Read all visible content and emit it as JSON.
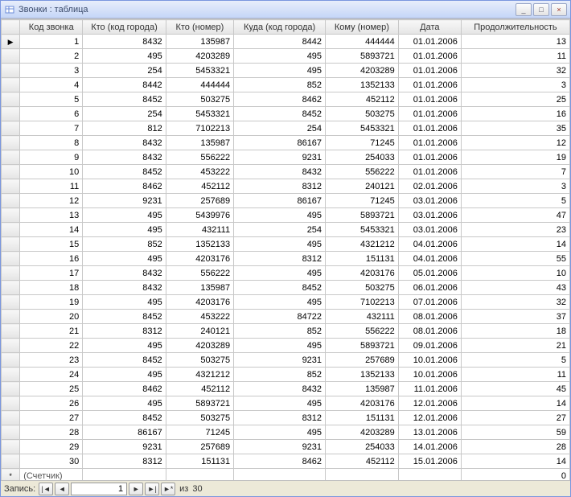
{
  "window": {
    "title": "Звонки : таблица",
    "minimize": "_",
    "maximize": "□",
    "close": "×"
  },
  "columns": [
    "Код звонка",
    "Кто (код города)",
    "Кто (номер)",
    "Куда (код города)",
    "Кому (номер)",
    "Дата",
    "Продолжительность"
  ],
  "rows": [
    {
      "marker": "▶",
      "c": [
        "1",
        "8432",
        "135987",
        "8442",
        "444444",
        "01.01.2006",
        "13"
      ]
    },
    {
      "marker": "",
      "c": [
        "2",
        "495",
        "4203289",
        "495",
        "5893721",
        "01.01.2006",
        "11"
      ]
    },
    {
      "marker": "",
      "c": [
        "3",
        "254",
        "5453321",
        "495",
        "4203289",
        "01.01.2006",
        "32"
      ]
    },
    {
      "marker": "",
      "c": [
        "4",
        "8442",
        "444444",
        "852",
        "1352133",
        "01.01.2006",
        "3"
      ]
    },
    {
      "marker": "",
      "c": [
        "5",
        "8452",
        "503275",
        "8462",
        "452112",
        "01.01.2006",
        "25"
      ]
    },
    {
      "marker": "",
      "c": [
        "6",
        "254",
        "5453321",
        "8452",
        "503275",
        "01.01.2006",
        "16"
      ]
    },
    {
      "marker": "",
      "c": [
        "7",
        "812",
        "7102213",
        "254",
        "5453321",
        "01.01.2006",
        "35"
      ]
    },
    {
      "marker": "",
      "c": [
        "8",
        "8432",
        "135987",
        "86167",
        "71245",
        "01.01.2006",
        "12"
      ]
    },
    {
      "marker": "",
      "c": [
        "9",
        "8432",
        "556222",
        "9231",
        "254033",
        "01.01.2006",
        "19"
      ]
    },
    {
      "marker": "",
      "c": [
        "10",
        "8452",
        "453222",
        "8432",
        "556222",
        "01.01.2006",
        "7"
      ]
    },
    {
      "marker": "",
      "c": [
        "11",
        "8462",
        "452112",
        "8312",
        "240121",
        "02.01.2006",
        "3"
      ]
    },
    {
      "marker": "",
      "c": [
        "12",
        "9231",
        "257689",
        "86167",
        "71245",
        "03.01.2006",
        "5"
      ]
    },
    {
      "marker": "",
      "c": [
        "13",
        "495",
        "5439976",
        "495",
        "5893721",
        "03.01.2006",
        "47"
      ]
    },
    {
      "marker": "",
      "c": [
        "14",
        "495",
        "432111",
        "254",
        "5453321",
        "03.01.2006",
        "23"
      ]
    },
    {
      "marker": "",
      "c": [
        "15",
        "852",
        "1352133",
        "495",
        "4321212",
        "04.01.2006",
        "14"
      ]
    },
    {
      "marker": "",
      "c": [
        "16",
        "495",
        "4203176",
        "8312",
        "151131",
        "04.01.2006",
        "55"
      ]
    },
    {
      "marker": "",
      "c": [
        "17",
        "8432",
        "556222",
        "495",
        "4203176",
        "05.01.2006",
        "10"
      ]
    },
    {
      "marker": "",
      "c": [
        "18",
        "8432",
        "135987",
        "8452",
        "503275",
        "06.01.2006",
        "43"
      ]
    },
    {
      "marker": "",
      "c": [
        "19",
        "495",
        "4203176",
        "495",
        "7102213",
        "07.01.2006",
        "32"
      ]
    },
    {
      "marker": "",
      "c": [
        "20",
        "8452",
        "453222",
        "84722",
        "432111",
        "08.01.2006",
        "37"
      ]
    },
    {
      "marker": "",
      "c": [
        "21",
        "8312",
        "240121",
        "852",
        "556222",
        "08.01.2006",
        "18"
      ]
    },
    {
      "marker": "",
      "c": [
        "22",
        "495",
        "4203289",
        "495",
        "5893721",
        "09.01.2006",
        "21"
      ]
    },
    {
      "marker": "",
      "c": [
        "23",
        "8452",
        "503275",
        "9231",
        "257689",
        "10.01.2006",
        "5"
      ]
    },
    {
      "marker": "",
      "c": [
        "24",
        "495",
        "4321212",
        "852",
        "1352133",
        "10.01.2006",
        "11"
      ]
    },
    {
      "marker": "",
      "c": [
        "25",
        "8462",
        "452112",
        "8432",
        "135987",
        "11.01.2006",
        "45"
      ]
    },
    {
      "marker": "",
      "c": [
        "26",
        "495",
        "5893721",
        "495",
        "4203176",
        "12.01.2006",
        "14"
      ]
    },
    {
      "marker": "",
      "c": [
        "27",
        "8452",
        "503275",
        "8312",
        "151131",
        "12.01.2006",
        "27"
      ]
    },
    {
      "marker": "",
      "c": [
        "28",
        "86167",
        "71245",
        "495",
        "4203289",
        "13.01.2006",
        "59"
      ]
    },
    {
      "marker": "",
      "c": [
        "29",
        "9231",
        "257689",
        "9231",
        "254033",
        "14.01.2006",
        "28"
      ]
    },
    {
      "marker": "",
      "c": [
        "30",
        "8312",
        "151131",
        "8462",
        "452112",
        "15.01.2006",
        "14"
      ]
    }
  ],
  "new_row": {
    "marker": "*",
    "counter_label": "(Счетчик)",
    "last_value": "0"
  },
  "nav": {
    "label": "Запись:",
    "first": "|◄",
    "prev": "◄",
    "current": "1",
    "next": "►",
    "last": "►|",
    "new": "►*",
    "of_label": "из",
    "total": "30"
  }
}
